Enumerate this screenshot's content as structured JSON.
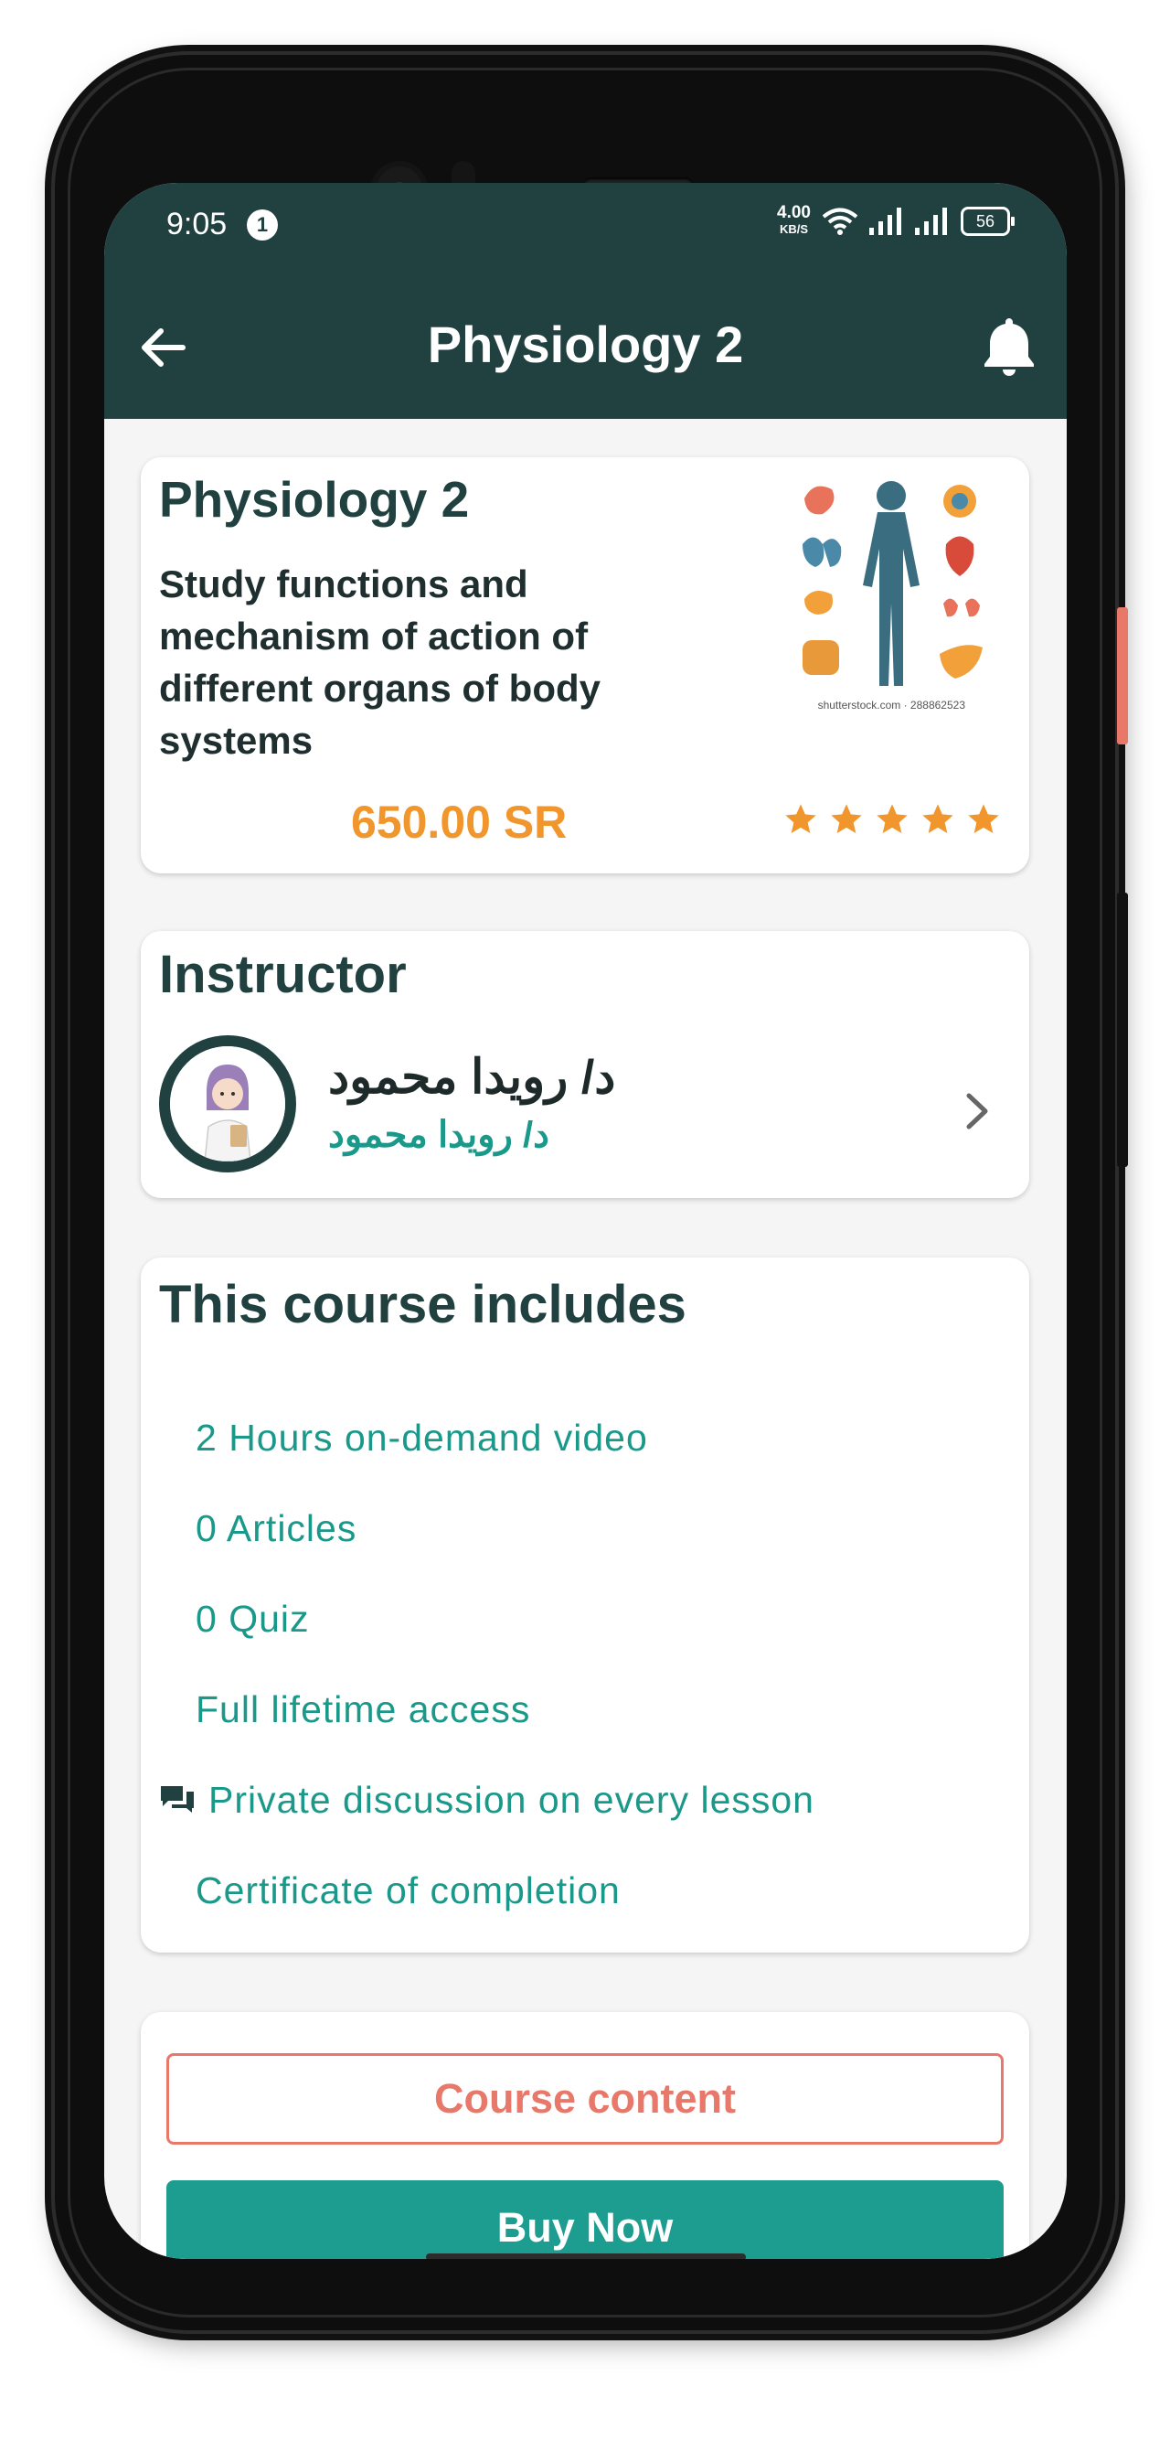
{
  "status_bar": {
    "time": "9:05",
    "notification_count": "1",
    "net_speed_value": "4.00",
    "net_speed_unit": "KB/S",
    "battery": "56"
  },
  "app_bar": {
    "title": "Physiology 2",
    "back_icon": "arrow-left-icon",
    "bell_icon": "bell-icon"
  },
  "course": {
    "name": "Physiology 2",
    "description": "Study functions and mechanism of action of different organs of body systems",
    "price": "650.00 SR",
    "rating_stars": 5,
    "image_credit": "shutterstock.com · 288862523",
    "accent": "#f0962c"
  },
  "instructor": {
    "heading": "Instructor",
    "name": "د/ رويدا محمود",
    "subtitle": "د/ رويدا محمود"
  },
  "includes": {
    "heading": "This course includes",
    "items": [
      {
        "label": "2 Hours on-demand video",
        "icon": ""
      },
      {
        "label": "0 Articles",
        "icon": ""
      },
      {
        "label": "0 Quiz",
        "icon": ""
      },
      {
        "label": "Full lifetime access",
        "icon": ""
      },
      {
        "label": "Private discussion on every lesson",
        "icon": "chat-bubbles-icon"
      },
      {
        "label": "Certificate of completion",
        "icon": ""
      }
    ]
  },
  "actions": {
    "course_content": "Course content",
    "buy_now": "Buy Now"
  },
  "colors": {
    "header": "#214141",
    "teal": "#1a998a",
    "outline": "#e8786a"
  }
}
